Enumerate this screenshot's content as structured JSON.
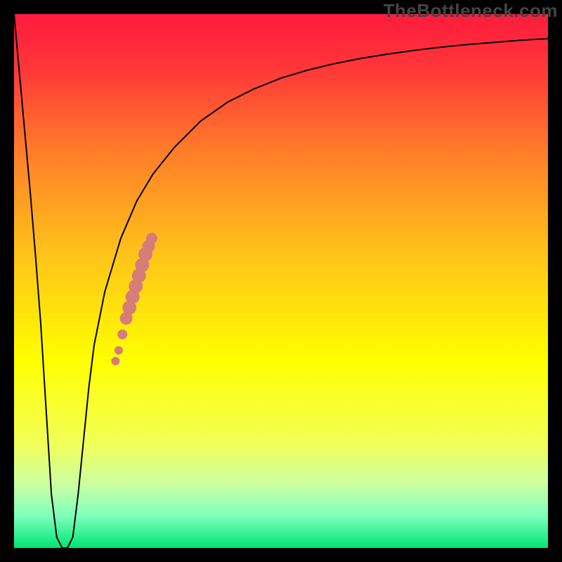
{
  "watermark": "TheBottleneck.com",
  "chart_data": {
    "type": "line",
    "title": "",
    "xlabel": "",
    "ylabel": "",
    "xlim": [
      0,
      100
    ],
    "ylim": [
      0,
      100
    ],
    "grid": false,
    "legend": false,
    "background_gradient": {
      "stops": [
        {
          "offset": 0.0,
          "color": "#ff1b3d"
        },
        {
          "offset": 0.1,
          "color": "#ff3639"
        },
        {
          "offset": 0.25,
          "color": "#ff7a2a"
        },
        {
          "offset": 0.45,
          "color": "#ffc319"
        },
        {
          "offset": 0.65,
          "color": "#ffff00"
        },
        {
          "offset": 0.8,
          "color": "#f2ff55"
        },
        {
          "offset": 0.88,
          "color": "#cdffa1"
        },
        {
          "offset": 0.94,
          "color": "#7dffbb"
        },
        {
          "offset": 1.0,
          "color": "#00e575"
        }
      ]
    },
    "series": [
      {
        "name": "bottleneck-curve",
        "color": "#000000",
        "x": [
          0,
          1,
          2,
          3,
          4,
          5,
          6,
          7,
          8,
          9,
          10,
          11,
          12,
          13,
          14,
          15,
          17,
          20,
          23,
          26,
          30,
          35,
          40,
          45,
          50,
          55,
          60,
          65,
          70,
          75,
          80,
          85,
          90,
          95,
          100
        ],
        "y": [
          100,
          89,
          78,
          67,
          55,
          42,
          26,
          10,
          2,
          0,
          0,
          2,
          10,
          20,
          30,
          38,
          48,
          58,
          65,
          70,
          75,
          80,
          83.5,
          86,
          88,
          89.5,
          90.7,
          91.7,
          92.5,
          93.2,
          93.8,
          94.3,
          94.7,
          95.1,
          95.4
        ]
      }
    ],
    "scatter": {
      "name": "highlighted-range",
      "color": "#d67d78",
      "points": [
        {
          "x": 19.0,
          "y": 35.0,
          "r": 6
        },
        {
          "x": 19.6,
          "y": 37.0,
          "r": 6
        },
        {
          "x": 20.3,
          "y": 40.0,
          "r": 7
        },
        {
          "x": 21.0,
          "y": 43.0,
          "r": 9
        },
        {
          "x": 21.6,
          "y": 45.0,
          "r": 10
        },
        {
          "x": 22.2,
          "y": 47.0,
          "r": 10
        },
        {
          "x": 22.8,
          "y": 49.0,
          "r": 10
        },
        {
          "x": 23.4,
          "y": 51.0,
          "r": 10
        },
        {
          "x": 24.0,
          "y": 53.0,
          "r": 10
        },
        {
          "x": 24.6,
          "y": 55.0,
          "r": 10
        },
        {
          "x": 25.2,
          "y": 56.5,
          "r": 9
        },
        {
          "x": 25.8,
          "y": 58.0,
          "r": 8
        }
      ]
    }
  }
}
